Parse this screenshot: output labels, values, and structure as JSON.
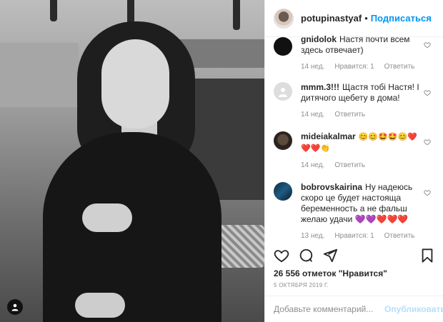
{
  "post": {
    "username": "potupinastyaf",
    "follow_label": "Подписаться",
    "separator": "•"
  },
  "comments": [
    {
      "username": "gnidolok",
      "text": "Настя почти всем здесь отвечает)",
      "time": "14 нед.",
      "likes": "Нравится: 1",
      "reply": "Ответить"
    },
    {
      "username": "mmm.3!!!",
      "text": "Щастя тобі Настя! І дитячого щебету в дома!",
      "time": "14 нед.",
      "reply": "Ответить"
    },
    {
      "username": "mideiakalmar",
      "text": "😊😊🤩🤩😊❤️ ❤️❤️👏",
      "time": "14 нед.",
      "reply": "Ответить"
    },
    {
      "username": "bobrovskairina",
      "text": "Ну надеюсь скоро це будет настояща беременность а не фальш желаю удачи 💜💜❤️❤️❤️",
      "time": "13 нед.",
      "likes": "Нравится: 1",
      "reply": "Ответить"
    }
  ],
  "likes_text": "26 556 отметок \"Нравится\"",
  "date_text": "5 октября 2019 г.",
  "add_comment": {
    "placeholder": "Добавьте комментарий...",
    "publish_label": "Опубликовать"
  },
  "colors": {
    "accent": "#0095f6",
    "publish_disabled": "#b2dffc",
    "meta": "#8e8e8e",
    "text": "#262626"
  },
  "icons": [
    "heart-icon",
    "comment-icon",
    "share-icon",
    "bookmark-icon",
    "user-tag-icon",
    "heart-small-icon"
  ]
}
